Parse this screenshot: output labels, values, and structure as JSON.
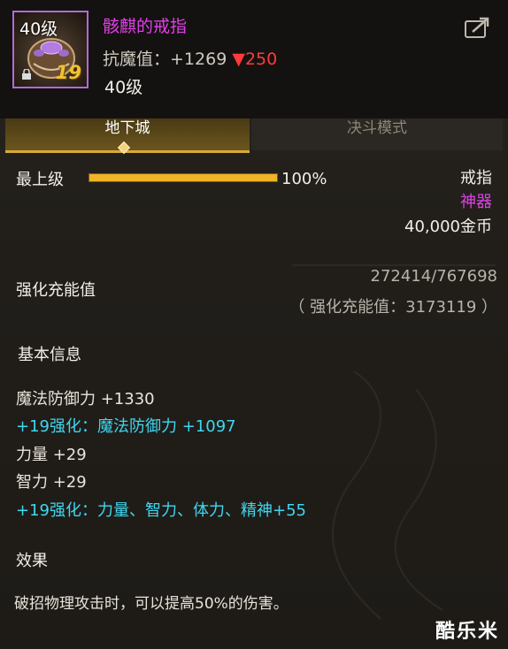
{
  "item": {
    "level_badge": "40级",
    "enhance_level": "19",
    "name": "骸麒的戒指",
    "stat_label": "抗魔值：",
    "stat_value": "+1269",
    "stat_diff": "▼250",
    "level_text": "40级",
    "name_color": "#e040e8"
  },
  "tabs": [
    {
      "label": "地下城",
      "active": true
    },
    {
      "label": "决斗模式",
      "active": false
    }
  ],
  "level_section": {
    "label": "最上级",
    "progress_text": "100%",
    "progress": 1.0,
    "type": "戒指",
    "rarity": "神器",
    "price": "40,000金币"
  },
  "charge": {
    "label": "强化充能值",
    "value": "272414/767698",
    "sub": "（ 强化充能值：3173119 ）"
  },
  "basic": {
    "title": "基本信息",
    "lines": [
      {
        "text": "魔法防御力 +1330",
        "color": "#e8e4da"
      },
      {
        "text": "+19强化：魔法防御力 +1097",
        "color": "#3fd7f0"
      },
      {
        "text": "力量 +29",
        "color": "#e8e4da"
      },
      {
        "text": "智力 +29",
        "color": "#e8e4da"
      },
      {
        "text": "+19强化：力量、智力、体力、精神+55",
        "color": "#3fd7f0"
      }
    ]
  },
  "effect": {
    "title": "效果",
    "text": "破招物理攻击时，可以提高50%的伤害。"
  },
  "watermark": "酷乐米",
  "icons": [
    "lock-icon",
    "share-icon",
    "ring-item-icon"
  ]
}
